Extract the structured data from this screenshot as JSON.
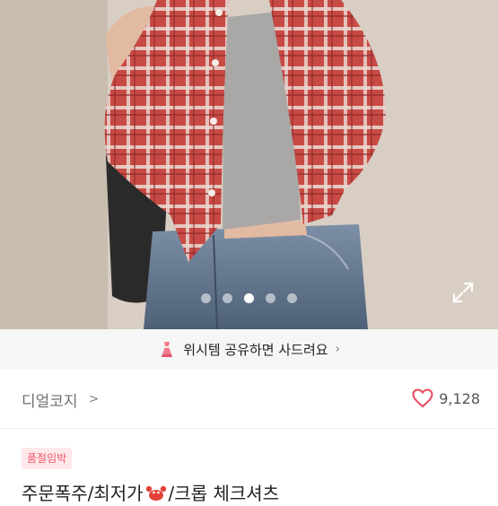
{
  "gallery": {
    "image_alt": "product photo - red plaid cropped shirt",
    "page_count": 5,
    "current_page": 3
  },
  "banner": {
    "icon": "dress-icon",
    "text": "위시템 공유하면 사드려요",
    "chevron": "›"
  },
  "shop": {
    "name": "디얼코지",
    "chevron": ">"
  },
  "likes": {
    "icon": "heart-icon",
    "count": "9,128"
  },
  "product": {
    "badge": "품절임박",
    "title_before": "주문폭주/최저가",
    "title_icon": "crab-emoji-icon",
    "title_after": "/크롭 체크셔츠"
  },
  "colors": {
    "accent": "#f0566c",
    "badge_bg": "#ffe8ea",
    "heart": "#e7495f"
  }
}
